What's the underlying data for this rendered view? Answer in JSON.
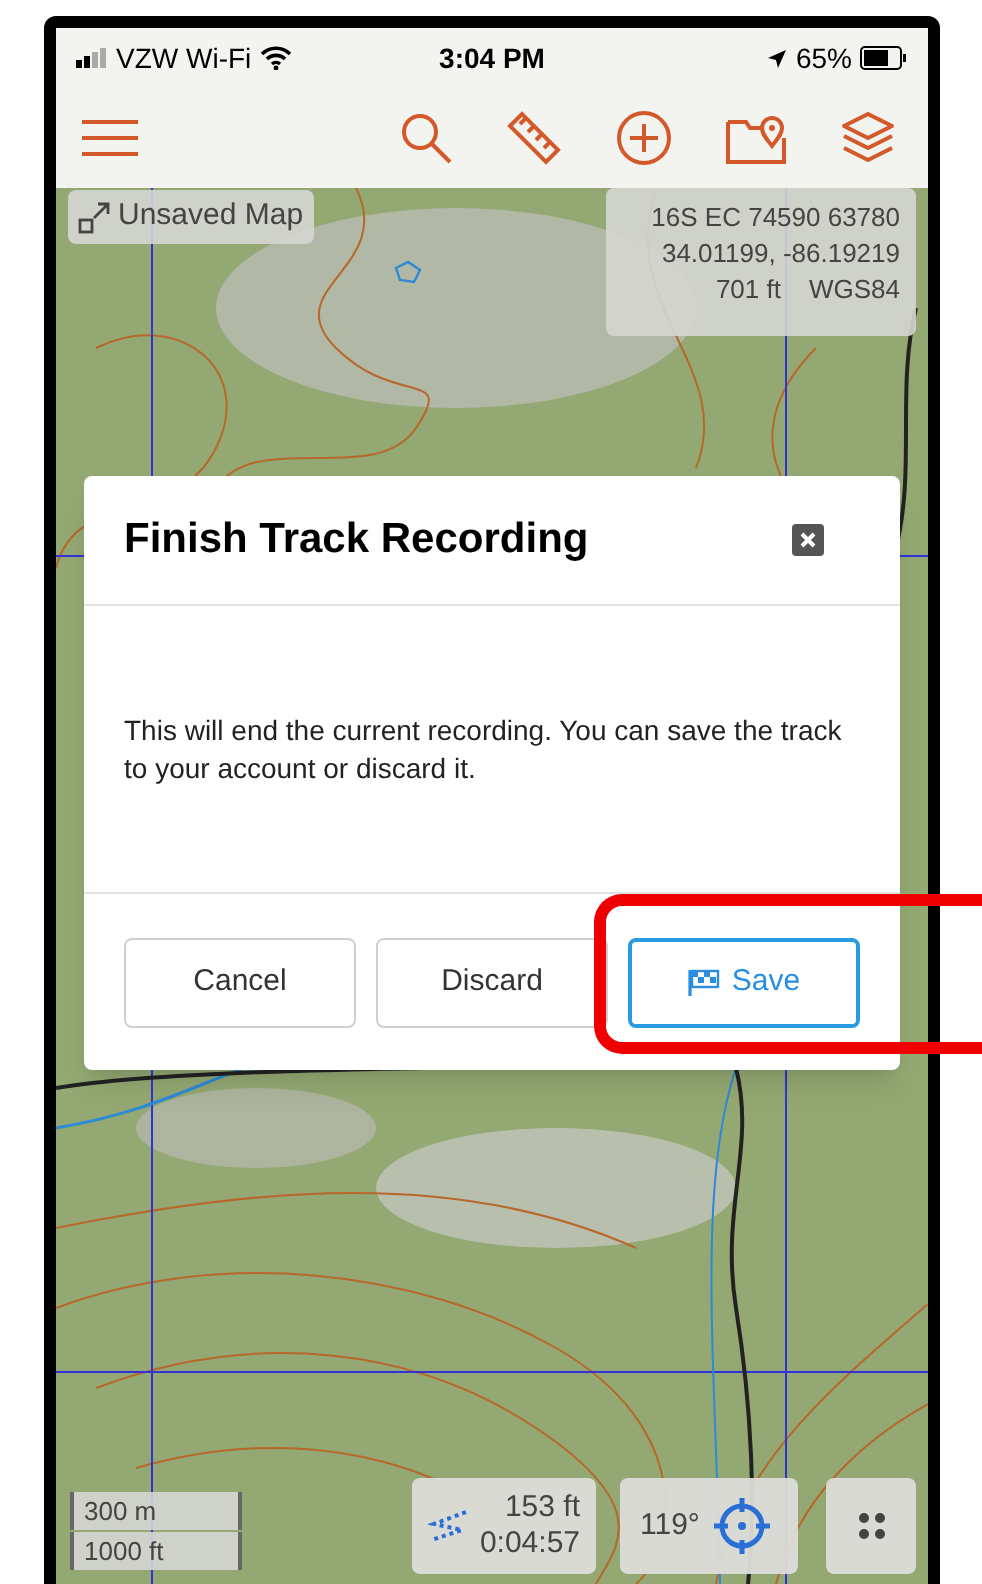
{
  "status_bar": {
    "carrier": "VZW Wi-Fi",
    "time": "3:04 PM",
    "battery": "65%"
  },
  "map_title": "Unsaved Map",
  "coordinates": {
    "lines": [
      "16S EC 74590 63780",
      "34.01199, -86.19219"
    ],
    "elevation": "701 ft",
    "datum": "WGS84"
  },
  "dialog": {
    "title": "Finish Track Recording",
    "message": "This will end the current recording. You can save the track to your account or discard it.",
    "buttons": [
      {
        "label": "Cancel",
        "kind": "default"
      },
      {
        "label": "Discard",
        "kind": "default"
      },
      {
        "label": "Save",
        "kind": "primary",
        "highlighted": true
      }
    ]
  },
  "scale": [
    "300 m",
    "1000 ft"
  ],
  "track_stats": {
    "distance": "153 ft",
    "duration": "0:04:57"
  },
  "heading": "119°"
}
